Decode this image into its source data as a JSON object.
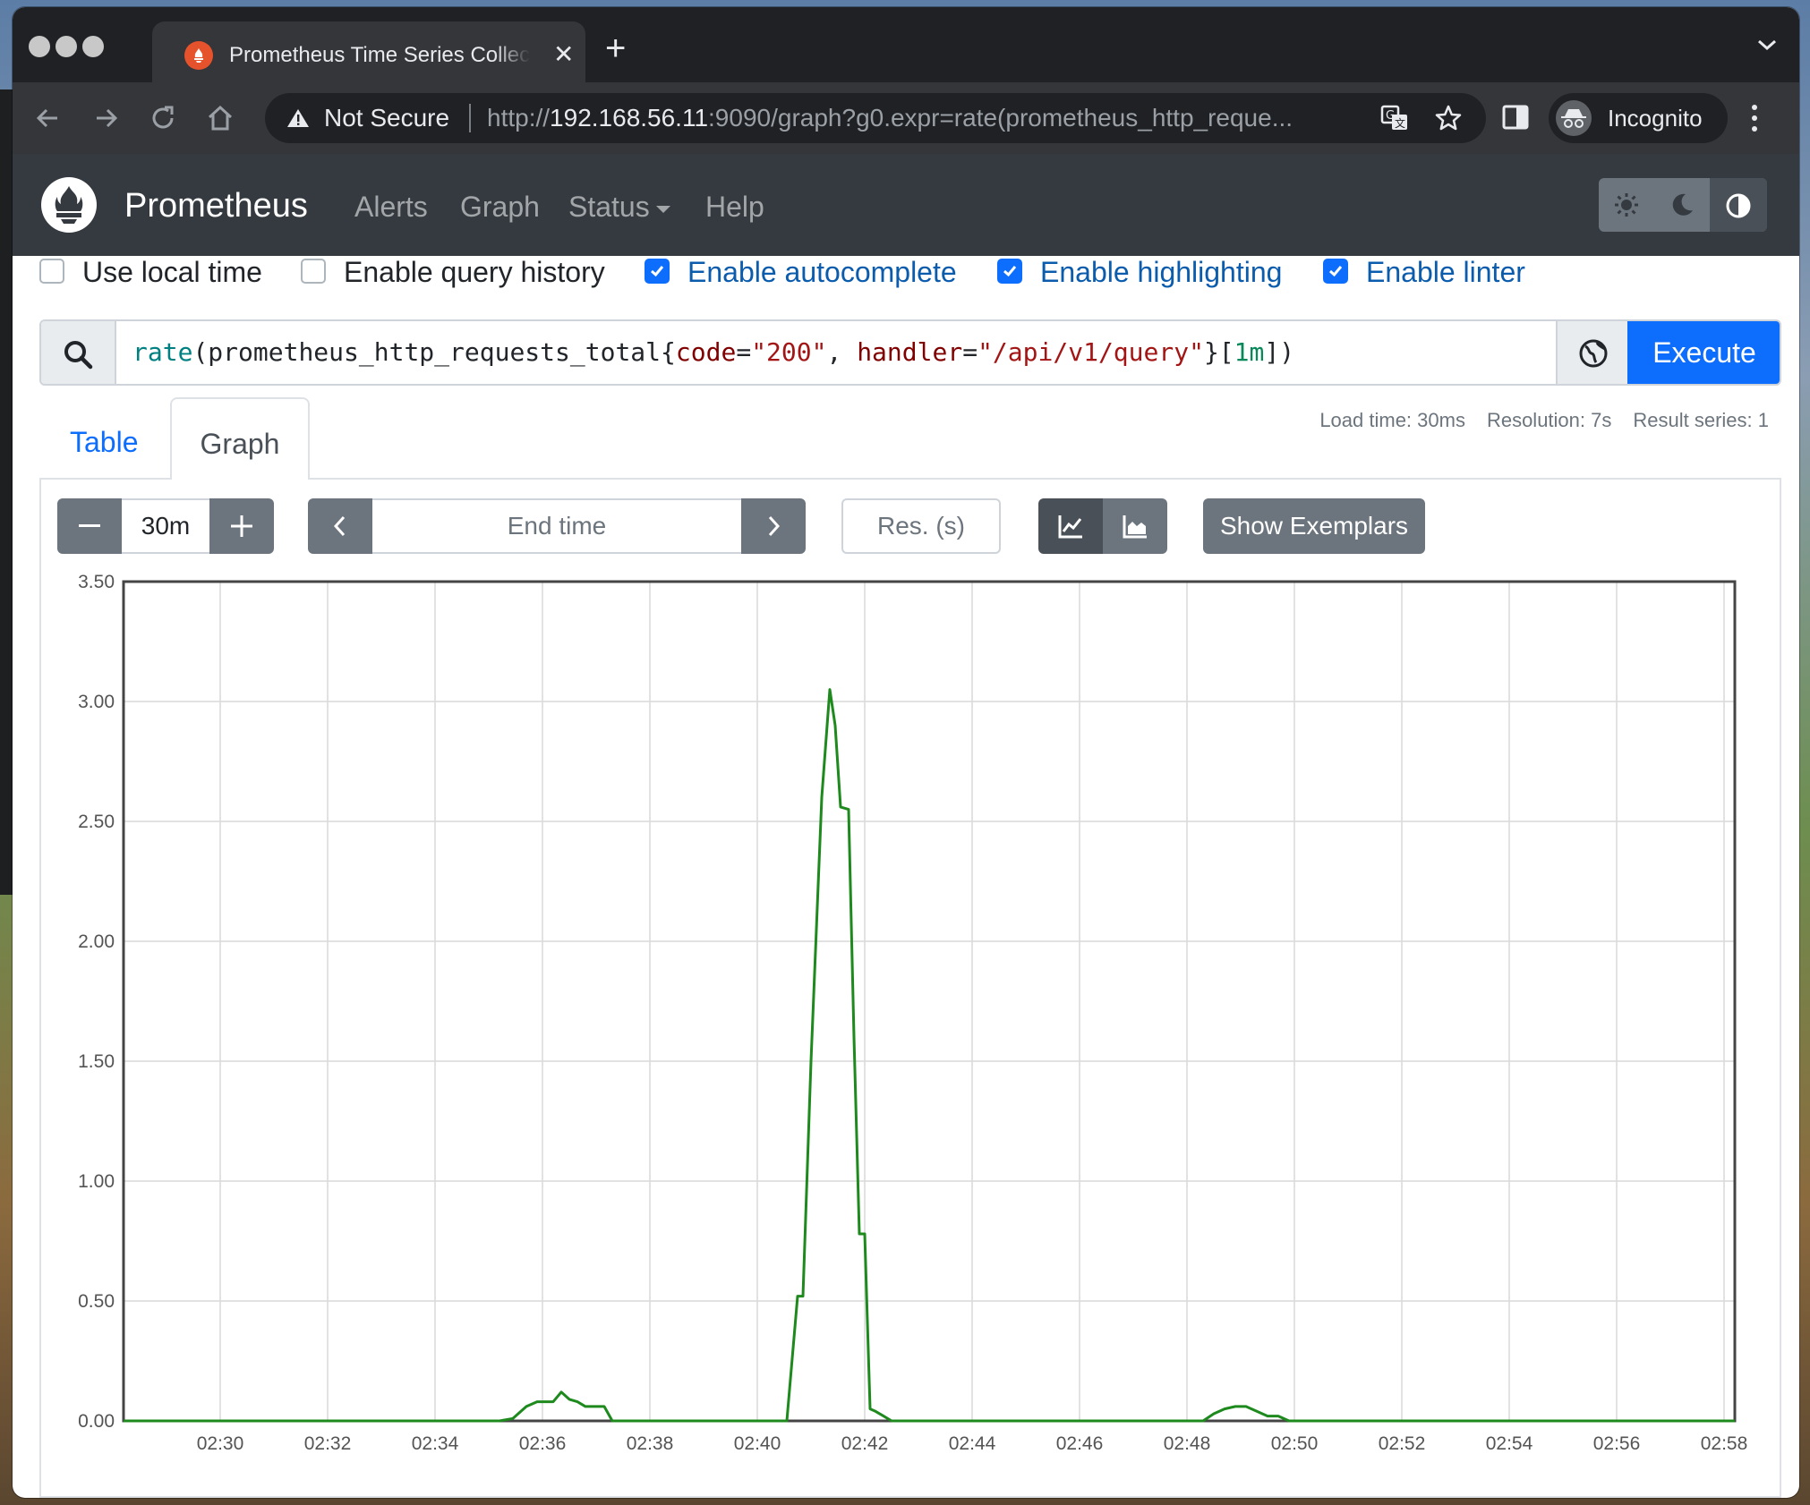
{
  "browser": {
    "tab_title": "Prometheus Time Series Collection and Processing Server",
    "new_tab_label": "+",
    "security_label": "Not Secure",
    "url_prefix": "http://",
    "url_host": "192.168.56.11",
    "url_rest": ":9090/graph?g0.expr=rate(prometheus_http_reque...",
    "profile_label": "Incognito"
  },
  "navbar": {
    "brand": "Prometheus",
    "links": [
      "Alerts",
      "Graph",
      "Status",
      "Help"
    ]
  },
  "options": [
    {
      "label": "Use local time",
      "checked": false
    },
    {
      "label": "Enable query history",
      "checked": false
    },
    {
      "label": "Enable autocomplete",
      "checked": true
    },
    {
      "label": "Enable highlighting",
      "checked": true
    },
    {
      "label": "Enable linter",
      "checked": true
    }
  ],
  "query": {
    "fn": "rate",
    "open": "(",
    "metric": "prometheus_http_requests_total{",
    "label1": "code",
    "eq": "=",
    "value1": "\"200\"",
    "comma": ", ",
    "label2": "handler",
    "value2": "\"/api/v1/query\"",
    "close_brace": "}[",
    "duration": "1m",
    "close": "])",
    "execute_label": "Execute"
  },
  "tabs": {
    "table": "Table",
    "graph": "Graph"
  },
  "stats": {
    "load_time": "Load time: 30ms",
    "resolution": "Resolution: 7s",
    "result_series": "Result series: 1"
  },
  "controls": {
    "range_value": "30m",
    "end_time_placeholder": "End time",
    "resolution_placeholder": "Res. (s)",
    "exemplars_label": "Show Exemplars"
  },
  "colors": {
    "series": "#1e8a1e",
    "accent": "#0d6efd",
    "navbar": "#343a40"
  },
  "chart_data": {
    "type": "line",
    "y_ticks": [
      "0.00",
      "0.50",
      "1.00",
      "1.50",
      "2.00",
      "2.50",
      "3.00",
      "3.50"
    ],
    "ylim": [
      0,
      3.5
    ],
    "x_ticks": [
      "02:30",
      "02:32",
      "02:34",
      "02:36",
      "02:38",
      "02:40",
      "02:42",
      "02:44",
      "02:46",
      "02:48",
      "02:50",
      "02:52",
      "02:54",
      "02:56",
      "02:58"
    ],
    "x_tick_minutes": [
      30,
      32,
      34,
      36,
      38,
      40,
      42,
      44,
      46,
      48,
      50,
      52,
      54,
      56,
      58
    ],
    "xlim_minutes": [
      28.2,
      58.2
    ],
    "grid": true,
    "series": [
      {
        "x_minutes": [
          28.2,
          35.2,
          35.45,
          35.7,
          35.9,
          36.2,
          36.35,
          36.5,
          36.65,
          36.8,
          36.95,
          37.15,
          37.3,
          37.5,
          40.55,
          40.75,
          40.85,
          41.0,
          41.2,
          41.35,
          41.45,
          41.55,
          41.7,
          41.8,
          41.9,
          42.0,
          42.1,
          42.2,
          42.35,
          42.5,
          48.3,
          48.5,
          48.7,
          48.9,
          49.1,
          49.3,
          49.5,
          49.7,
          49.9,
          58.2
        ],
        "y": [
          0,
          0,
          0.01,
          0.06,
          0.08,
          0.08,
          0.12,
          0.09,
          0.08,
          0.06,
          0.06,
          0.06,
          0.0,
          0.0,
          0.0,
          0.52,
          0.52,
          1.5,
          2.6,
          3.05,
          2.9,
          2.56,
          2.55,
          1.6,
          0.78,
          0.78,
          0.05,
          0.04,
          0.02,
          0.0,
          0.0,
          0.03,
          0.05,
          0.06,
          0.06,
          0.04,
          0.02,
          0.02,
          0.0,
          0.0
        ]
      }
    ]
  }
}
